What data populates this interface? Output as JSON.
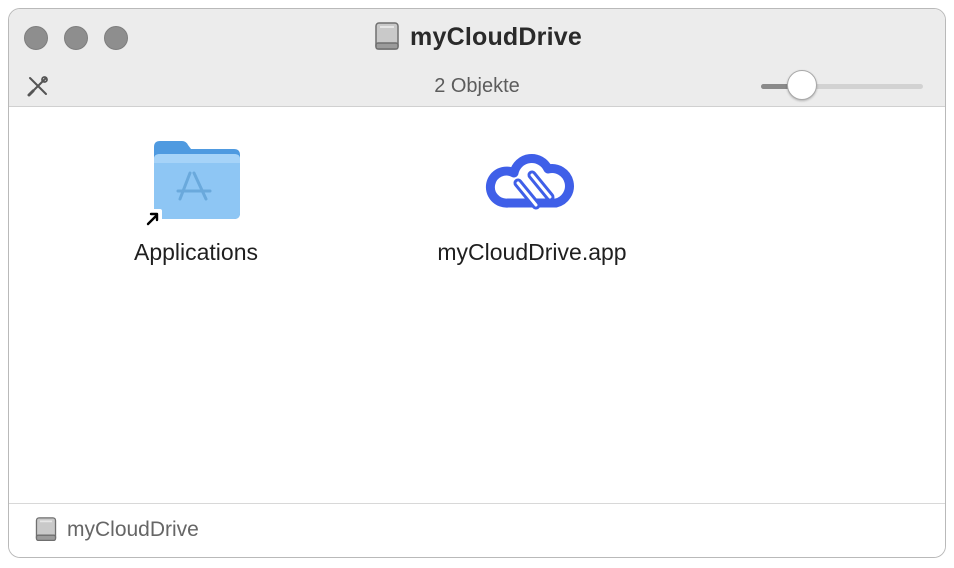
{
  "window": {
    "title": "myCloudDrive"
  },
  "toolbar": {
    "item_count": "2 Objekte",
    "icon_size_level": 0.2
  },
  "items": [
    {
      "label": "Applications",
      "icon": "applications-folder-alias-icon"
    },
    {
      "label": "myCloudDrive.app",
      "icon": "mycloudrive-app-icon"
    }
  ],
  "statusbar": {
    "path": "myCloudDrive"
  },
  "colors": {
    "app_blue": "#3f5fe8",
    "folder_blue": "#5aa5e3"
  }
}
